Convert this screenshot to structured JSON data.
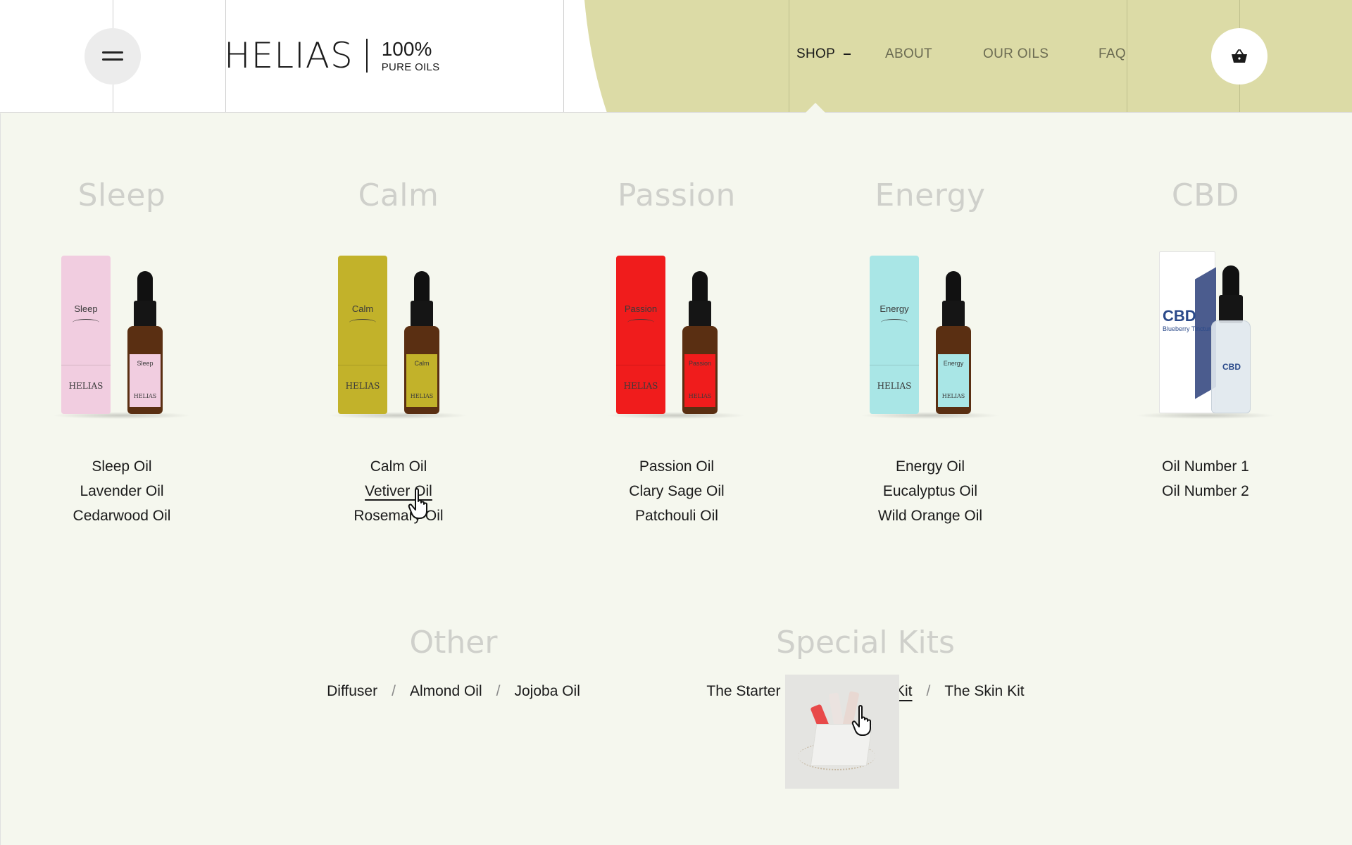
{
  "brand": {
    "wordmark": "HELIAS",
    "tagline_big": "100%",
    "tagline_small": "PURE OILS"
  },
  "nav": {
    "items": [
      {
        "label": "SHOP",
        "active": true
      },
      {
        "label": "ABOUT",
        "active": false
      },
      {
        "label": "OUR OILS",
        "active": false
      },
      {
        "label": "FAQ",
        "active": false
      }
    ]
  },
  "header": {
    "menu_icon": "hamburger-icon",
    "cart_icon": "basket-icon"
  },
  "colors": {
    "header_accent": "#dcdba6",
    "panel_bg": "#f5f7ee",
    "category_title": "#cfd0cb"
  },
  "categories": [
    {
      "title": "Sleep",
      "product_label": "Sleep",
      "product_brand": "HELIAS",
      "color": "#f1cde0",
      "links": [
        "Sleep Oil",
        "Lavender Oil",
        "Cedarwood Oil"
      ]
    },
    {
      "title": "Calm",
      "product_label": "Calm",
      "product_brand": "HELIAS",
      "color": "#c2b22a",
      "links": [
        "Calm Oil",
        "Vetiver Oil",
        "Rosemary Oil"
      ],
      "hovered_link": "Vetiver Oil"
    },
    {
      "title": "Passion",
      "product_label": "Passion",
      "product_brand": "HELIAS",
      "color": "#f01c1c",
      "links": [
        "Passion Oil",
        "Clary Sage Oil",
        "Patchouli Oil"
      ]
    },
    {
      "title": "Energy",
      "product_label": "Energy",
      "product_brand": "HELIAS",
      "color": "#a9e6e6",
      "links": [
        "Energy Oil",
        "Eucalyptus Oil",
        "Wild Orange Oil"
      ]
    },
    {
      "title": "CBD",
      "product_label": "CBD",
      "product_sub": "Blueberry Tincture",
      "links": [
        "Oil Number 1",
        "Oil Number 2"
      ]
    }
  ],
  "other": {
    "title": "Other",
    "links": [
      "Diffuser",
      "Almond Oil",
      "Jojoba Oil"
    ]
  },
  "kits": {
    "title": "Special Kits",
    "links": [
      "The Starter Kit",
      "The Hair Kit",
      "The Skin Kit"
    ],
    "hovered_link": "The Hair Kit"
  },
  "separator": "/"
}
